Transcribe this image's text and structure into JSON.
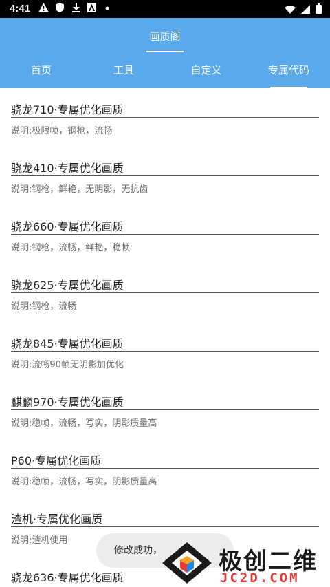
{
  "status_bar": {
    "time": "4:41",
    "icons_left": [
      "warning-icon",
      "shield-icon",
      "download-icon",
      "a-icon",
      "dot-icon"
    ],
    "icons_right": [
      "wifi-icon",
      "signal-icon",
      "battery-icon"
    ]
  },
  "app_bar": {
    "title": "画质阁"
  },
  "tabs": [
    {
      "label": "首页"
    },
    {
      "label": "工具"
    },
    {
      "label": "自定义"
    },
    {
      "label": "专属代码",
      "selected": true
    }
  ],
  "items": [
    {
      "title": "骁龙710·专属优化画质",
      "desc": "说明:极限帧，钢枪，流畅"
    },
    {
      "title": "骁龙410·专属优化画质",
      "desc": "说明:钢枪，鲜艳，无阴影，无抗齿"
    },
    {
      "title": "骁龙660·专属优化画质",
      "desc": "说明:钢枪，流畅，鲜艳，稳帧"
    },
    {
      "title": "骁龙625·专属优化画质",
      "desc": "说明:钢枪，流畅"
    },
    {
      "title": "骁龙845·专属优化画质",
      "desc": "说明:流畅90帧无阴影加优化"
    },
    {
      "title": "麒麟970·专属优化画质",
      "desc": "说明:稳帧，流畅，写实，阴影质量高"
    },
    {
      "title": "P60·专属优化画质",
      "desc": "说明:稳帧，流畅，写实，阴影质量高"
    },
    {
      "title": "渣机·专属优化画质",
      "desc": "说明:渣机使用"
    },
    {
      "title": "骁龙636·专属优化画质",
      "desc": ""
    }
  ],
  "toast": {
    "text": "修改成功，"
  },
  "watermark": {
    "text": "极创二维",
    "sub": "JC2D.COM"
  },
  "colors": {
    "primary": "#5aa9ec",
    "toast_bg": "#ececec"
  }
}
